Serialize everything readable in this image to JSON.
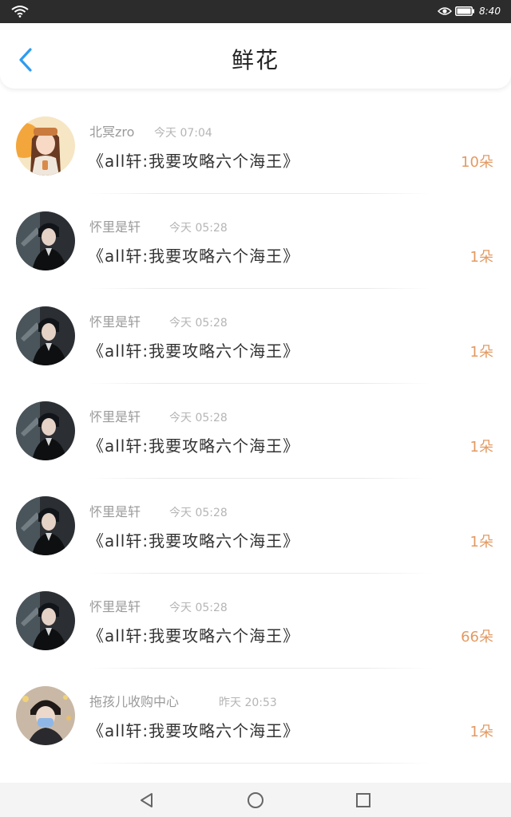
{
  "status_bar": {
    "time": "8:40",
    "icons": [
      "wifi-icon",
      "eye-icon",
      "battery-icon"
    ]
  },
  "header": {
    "title": "鲜花",
    "back_icon": "chevron-left-icon"
  },
  "colors": {
    "accent_blue": "#2e9cf0",
    "flower_count": "#e39a62",
    "name_gray": "#9a9a9a"
  },
  "items": [
    {
      "user": "北冥zro",
      "time": "今天 07:04",
      "book": "《all轩:我要攻略六个海王》",
      "count": "10朵",
      "avatar": "avatar-girl"
    },
    {
      "user": "怀里是轩",
      "time": "今天 05:28",
      "book": "《all轩:我要攻略六个海王》",
      "count": "1朵",
      "avatar": "avatar-boy"
    },
    {
      "user": "怀里是轩",
      "time": "今天 05:28",
      "book": "《all轩:我要攻略六个海王》",
      "count": "1朵",
      "avatar": "avatar-boy"
    },
    {
      "user": "怀里是轩",
      "time": "今天 05:28",
      "book": "《all轩:我要攻略六个海王》",
      "count": "1朵",
      "avatar": "avatar-boy"
    },
    {
      "user": "怀里是轩",
      "time": "今天 05:28",
      "book": "《all轩:我要攻略六个海王》",
      "count": "1朵",
      "avatar": "avatar-boy"
    },
    {
      "user": "怀里是轩",
      "time": "今天 05:28",
      "book": "《all轩:我要攻略六个海王》",
      "count": "66朵",
      "avatar": "avatar-boy"
    },
    {
      "user": "拖孩儿收购中心",
      "time": "昨天 20:53",
      "book": "《all轩:我要攻略六个海王》",
      "count": "1朵",
      "avatar": "avatar-boy-mask"
    }
  ],
  "nav_bar": {
    "buttons": [
      "back-triangle-icon",
      "home-circle-icon",
      "recents-square-icon"
    ]
  }
}
